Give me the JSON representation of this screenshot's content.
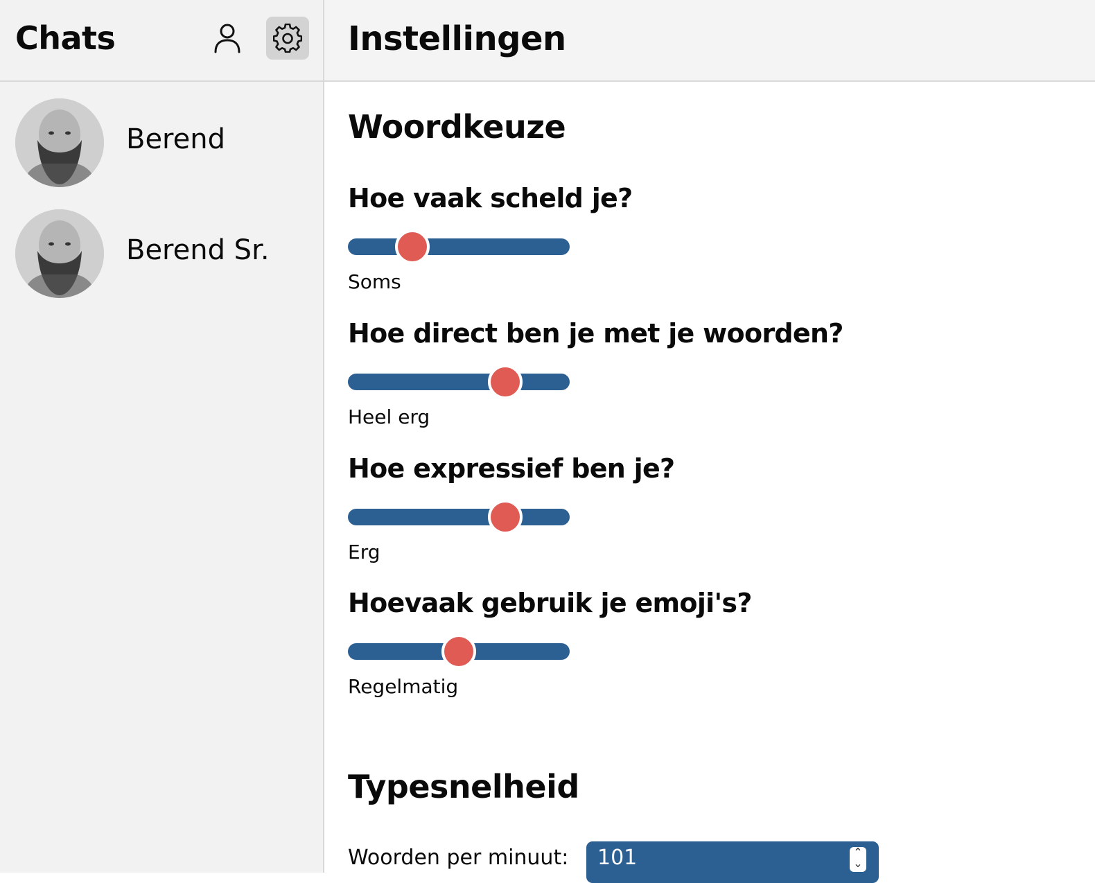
{
  "sidebar": {
    "title": "Chats",
    "profile_icon": "user-icon",
    "settings_icon": "gear-icon",
    "chats": [
      {
        "name": "Berend"
      },
      {
        "name": "Berend Sr."
      }
    ]
  },
  "main": {
    "title": "Instellingen",
    "sections": {
      "woordkeuze": {
        "title": "Woordkeuze",
        "questions": [
          {
            "label": "Hoe vaak scheld je?",
            "value_label": "Soms",
            "level": 0.29
          },
          {
            "label": "Hoe direct ben je met je woorden?",
            "value_label": "Heel erg",
            "level": 0.71
          },
          {
            "label": "Hoe expressief ben je?",
            "value_label": "Erg",
            "level": 0.71
          },
          {
            "label": "Hoevaak gebruik je emoji's?",
            "value_label": "Regelmatig",
            "level": 0.5
          }
        ]
      },
      "typesnelheid": {
        "title": "Typesnelheid",
        "wpm_label": "Woorden per minuut:",
        "wpm_value": "101"
      }
    }
  },
  "colors": {
    "slider_track": "#2c5f92",
    "slider_thumb": "#e05b54",
    "sidebar_bg": "#f2f2f2",
    "active_button_bg": "#d3d3d3"
  }
}
